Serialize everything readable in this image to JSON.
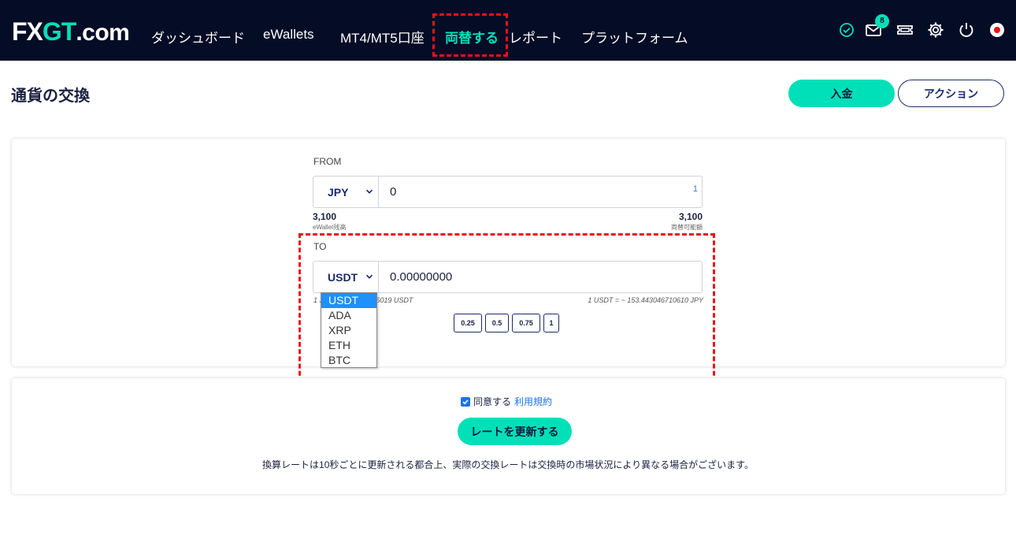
{
  "nav": {
    "logo_main": "FX",
    "logo_accent": "GT",
    "logo_suffix": ".com",
    "items": [
      {
        "label": "ダッシュボード"
      },
      {
        "label": "eWallets"
      },
      {
        "label": "MT4/MT5口座"
      },
      {
        "label": "両替する"
      },
      {
        "label": "レポート"
      },
      {
        "label": "プラットフォーム"
      }
    ],
    "mail_badge": "8"
  },
  "header": {
    "title": "通貨の交換",
    "deposit_label": "入金",
    "action_label": "アクション"
  },
  "exchange": {
    "from_label": "FROM",
    "from_currency": "JPY",
    "from_amount": "0",
    "from_mini": "1",
    "wallet_balance": "3,100",
    "wallet_balance_caption": "eWallet残高",
    "available_balance": "3,100",
    "available_caption": "両替可能額",
    "to_label": "TO",
    "to_currency": "USDT",
    "to_amount": "0.00000000",
    "rate_left": "1 JPY = ~ 0.0065076019 USDT",
    "rate_right": "1 USDT = ~ 153.443046710610 JPY",
    "quick_amounts": [
      "0.25",
      "0.5",
      "0.75",
      "1"
    ],
    "dropdown_options": [
      "USDT",
      "ADA",
      "XRP",
      "ETH",
      "BTC"
    ]
  },
  "footer": {
    "agree_label": "同意する",
    "terms_link": "利用規約",
    "refresh_label": "レートを更新する",
    "note": "換算レートは10秒ごとに更新される都合上、実際の交換レートは交換時の市場状況により異なる場合がございます。"
  },
  "colors": {
    "nav_bg": "#050c26",
    "accent": "#00e0b8",
    "highlight": "#e8121b",
    "link": "#1a73e8"
  }
}
